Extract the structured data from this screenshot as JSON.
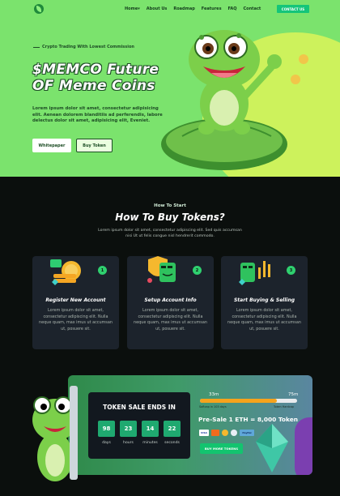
{
  "nav": {
    "items": [
      "Home",
      "About Us",
      "Roadmap",
      "Features",
      "FAQ",
      "Contact"
    ],
    "home_caret": "▾",
    "cta": "CONTACT US"
  },
  "hero": {
    "kicker": "Crypto Trading With Lowest Commission",
    "title_line1": "$MEMCO Future",
    "title_line2": "OF Meme Coins",
    "description": "Lorem ipsum dolor sit amet, consectetur adipisicing elit. Aenean dolorem blanditiis ad perferendis, labore delectus dolor sit amet, adipisicing elit, Eveniet.",
    "btn_whitepaper": "Whitepaper",
    "btn_buy": "Buy Token"
  },
  "how": {
    "kicker": "How To Start",
    "title": "How To Buy Tokens?",
    "description": "Lorem ipsum dolor sit amet, consectetur adipiscing elit. Sed quis accumsan nisi Ut ut felis congue nisl hendrerit commodo.",
    "cards": [
      {
        "num": "1",
        "title": "Register New Account",
        "text": "Lorem ipsum dolor sit amet, consectetur adipiscing elit. Nulla neque quam, max imus ut accumsan ut, posuere sit."
      },
      {
        "num": "2",
        "title": "Setup Account Info",
        "text": "Lorem ipsum dolor sit amet, consectetur adipiscing elit. Nulla neque quam, max imus ut accumsan ut, posuere sit."
      },
      {
        "num": "3",
        "title": "Start Buying & Selling",
        "text": "Lorem ipsum dolor sit amet, consectetur adipiscing elit. Nulla neque quam, max imus ut accumsan ut, posuere sit."
      }
    ]
  },
  "sale": {
    "title": "TOKEN SALE ENDS IN",
    "countdown": [
      {
        "value": "98",
        "label": "days"
      },
      {
        "value": "23",
        "label": "hours"
      },
      {
        "value": "14",
        "label": "minutes"
      },
      {
        "value": "22",
        "label": "seconds"
      }
    ],
    "progress_start": "33m",
    "progress_end": "75m",
    "progress_fraction": 0.79,
    "progress_caption_left": "Softcap in 103 days",
    "progress_caption_right": "Token Hardcap",
    "presale_text": "Pre-Sale 1 ETH = 8,000 Token",
    "payments": [
      "VISA",
      "",
      "",
      "",
      "PayPal"
    ],
    "buy_more": "BUY MORE TOKENS"
  },
  "colors": {
    "hero_bg": "#7be36d",
    "accent_green": "#14c57a",
    "page_bg": "#0b0f0d",
    "progress": "#f6a31c"
  }
}
